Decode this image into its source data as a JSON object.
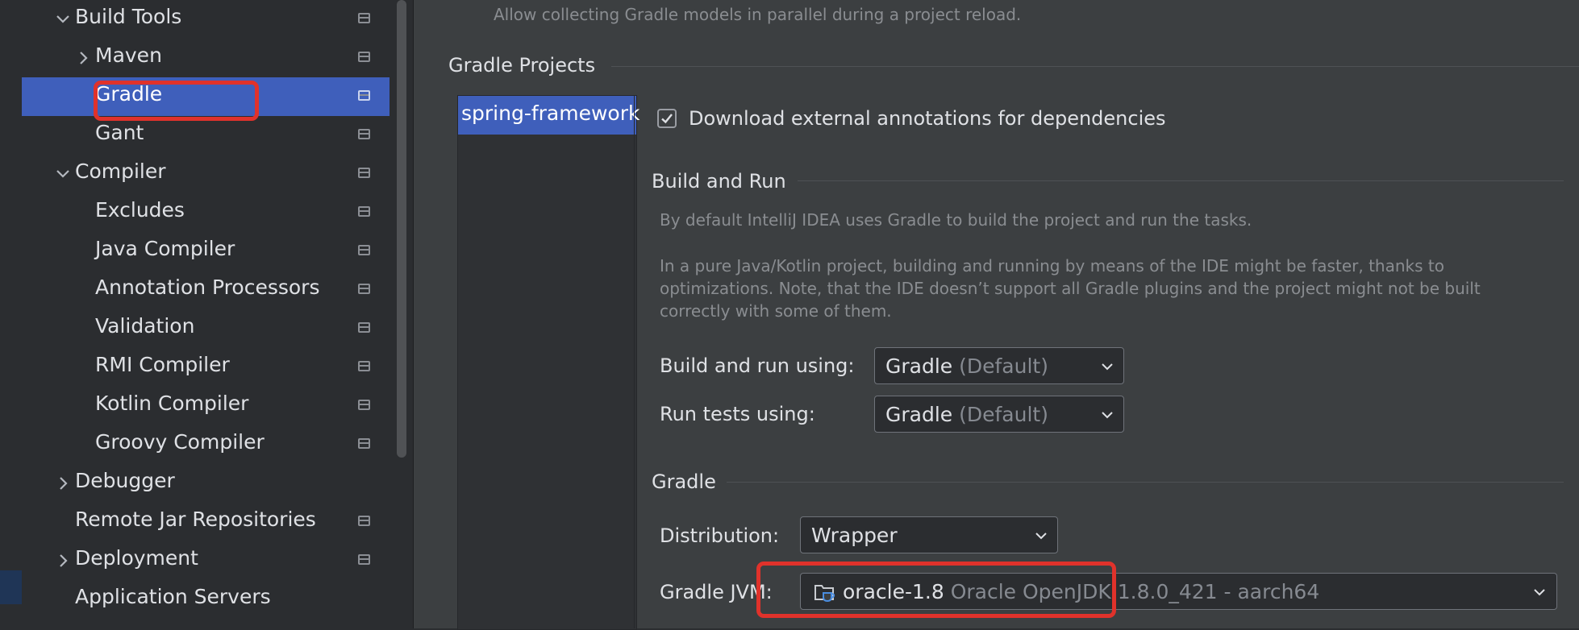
{
  "sidebar": {
    "items": [
      {
        "label": "Build Tools",
        "expanded": true
      },
      {
        "label": "Maven",
        "expanded": false
      },
      {
        "label": "Gradle",
        "selected": true
      },
      {
        "label": "Gant"
      },
      {
        "label": "Compiler",
        "expanded": true
      },
      {
        "label": "Excludes"
      },
      {
        "label": "Java Compiler"
      },
      {
        "label": "Annotation Processors"
      },
      {
        "label": "Validation"
      },
      {
        "label": "RMI Compiler"
      },
      {
        "label": "Kotlin Compiler"
      },
      {
        "label": "Groovy Compiler"
      },
      {
        "label": "Debugger",
        "expanded": false
      },
      {
        "label": "Remote Jar Repositories"
      },
      {
        "label": "Deployment",
        "expanded": false
      },
      {
        "label": "Application Servers"
      }
    ]
  },
  "main": {
    "top_hint": "Allow collecting Gradle models in parallel during a project reload.",
    "gradle_projects_title": "Gradle Projects",
    "project_item": "spring-framework",
    "download_annotations_label": "Download external annotations for dependencies",
    "download_annotations_checked": true,
    "build_and_run_title": "Build and Run",
    "build_and_run_desc1": "By default IntelliJ IDEA uses Gradle to build the project and run the tasks.",
    "build_and_run_desc2_line1": "In a pure Java/Kotlin project, building and running by means of the IDE might be faster, thanks to",
    "build_and_run_desc2_line2": "optimizations. Note, that the IDE doesn’t support all Gradle plugins and the project might not be built",
    "build_and_run_desc2_line3": "correctly with some of them.",
    "build_run_using_label": "Build and run using:",
    "build_run_using_value": "Gradle",
    "build_run_using_suffix": "(Default)",
    "run_tests_using_label": "Run tests using:",
    "run_tests_using_value": "Gradle",
    "run_tests_using_suffix": "(Default)",
    "gradle_title": "Gradle",
    "distribution_label": "Distribution:",
    "distribution_value": "Wrapper",
    "gradle_jvm_label": "Gradle JVM:",
    "gradle_jvm_value": "oracle-1.8",
    "gradle_jvm_detail": "Oracle OpenJDK 1.8.0_421 - aarch64"
  },
  "colors": {
    "selection": "#3f5fbb",
    "highlight": "#e0322b"
  },
  "icons": [
    "chevron-down-icon",
    "chevron-right-icon",
    "project-settings-icon",
    "checkmark-icon",
    "jdk-folder-icon"
  ]
}
